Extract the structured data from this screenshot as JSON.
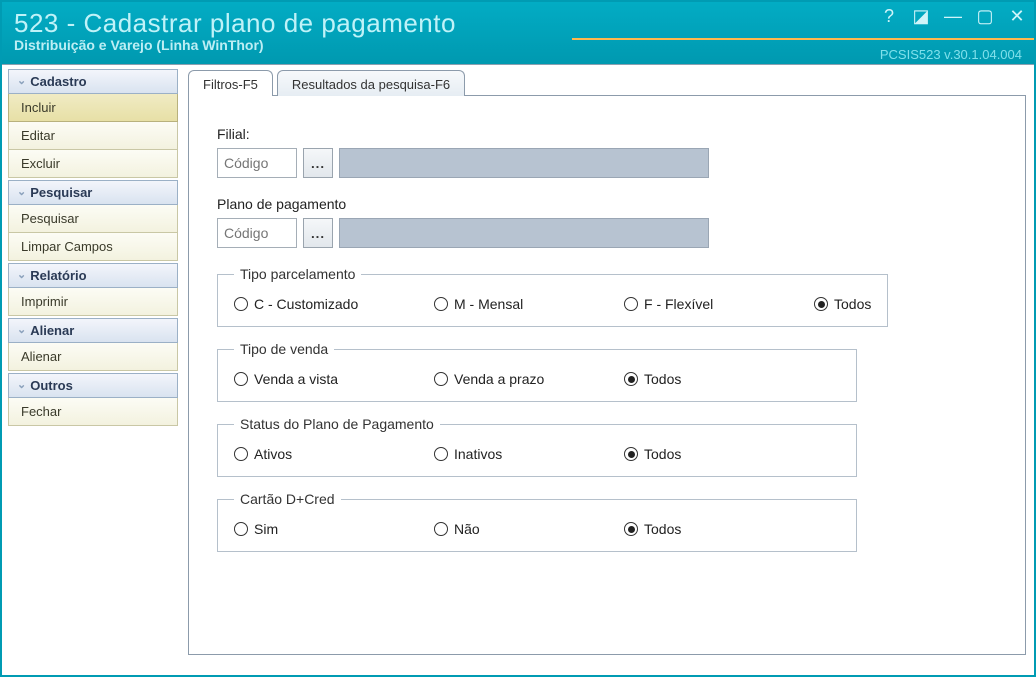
{
  "window": {
    "title": "523 - Cadastrar plano de pagamento",
    "subtitle": "Distribuição e Varejo (Linha WinThor)",
    "version": "PCSIS523  v.30.1.04.004"
  },
  "sidebar": {
    "groups": [
      {
        "header": "Cadastro",
        "items": [
          "Incluir",
          "Editar",
          "Excluir"
        ],
        "active_index": 0
      },
      {
        "header": "Pesquisar",
        "items": [
          "Pesquisar",
          "Limpar Campos"
        ]
      },
      {
        "header": "Relatório",
        "items": [
          "Imprimir"
        ]
      },
      {
        "header": "Alienar",
        "items": [
          "Alienar"
        ]
      },
      {
        "header": "Outros",
        "items": [
          "Fechar"
        ]
      }
    ]
  },
  "tabs": {
    "filtros": "Filtros-F5",
    "resultados": "Resultados da pesquisa-F6",
    "active": "filtros"
  },
  "form": {
    "filial_label": "Filial:",
    "plano_label": "Plano de pagamento",
    "code_placeholder": "Código",
    "ellipsis": "...",
    "tipo_parcelamento": {
      "legend": "Tipo parcelamento",
      "opts": {
        "c": "C - Customizado",
        "m": "M - Mensal",
        "f": "F - Flexível",
        "todos": "Todos"
      },
      "selected": "todos"
    },
    "tipo_venda": {
      "legend": "Tipo de venda",
      "opts": {
        "vista": "Venda a vista",
        "prazo": "Venda a prazo",
        "todos": "Todos"
      },
      "selected": "todos"
    },
    "status": {
      "legend": "Status do Plano de Pagamento",
      "opts": {
        "ativos": "Ativos",
        "inativos": "Inativos",
        "todos": "Todos"
      },
      "selected": "todos"
    },
    "cartao": {
      "legend": "Cartão D+Cred",
      "opts": {
        "sim": "Sim",
        "nao": "Não",
        "todos": "Todos"
      },
      "selected": "todos"
    }
  }
}
